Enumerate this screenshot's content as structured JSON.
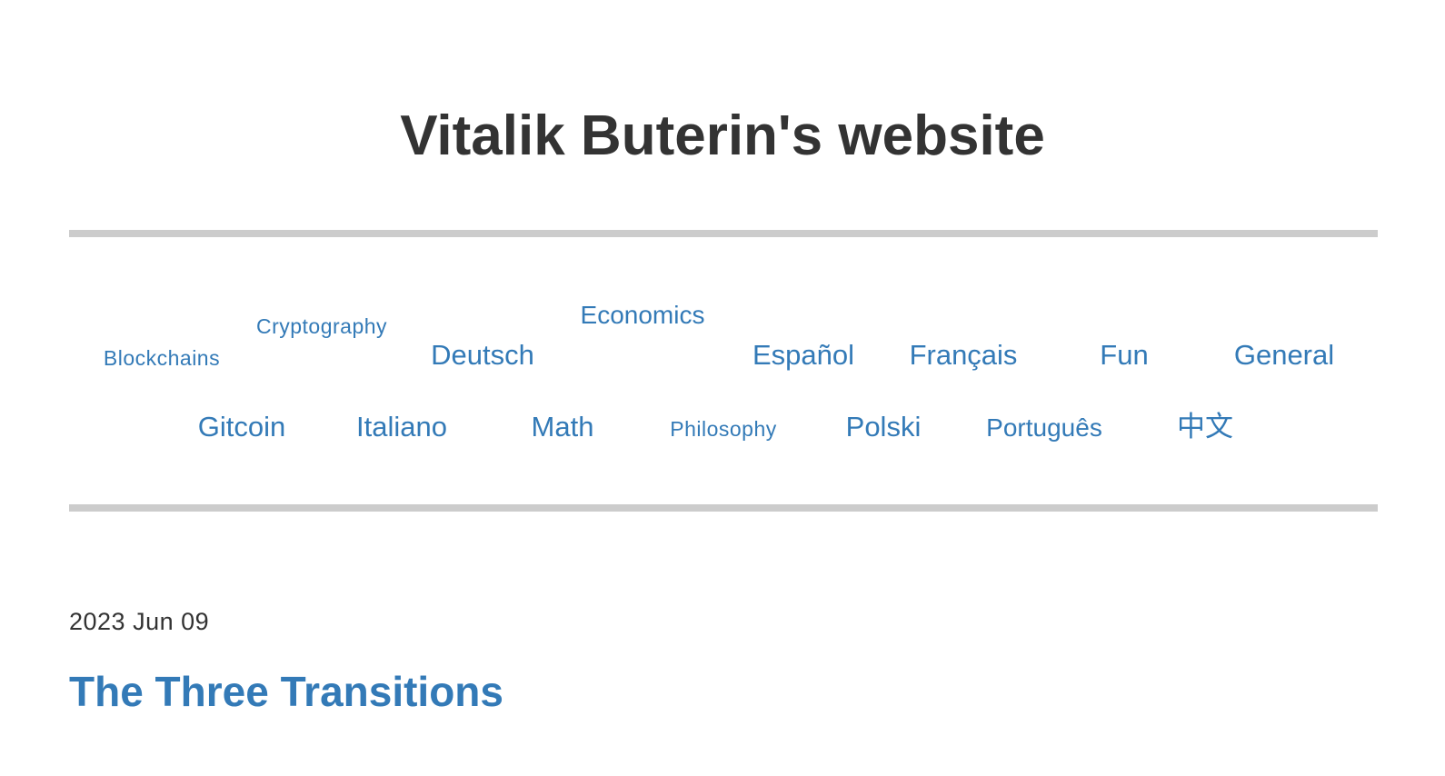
{
  "site": {
    "title": "Vitalik Buterin's website",
    "link_color": "#337ab7",
    "text_color": "#333333",
    "rule_color": "#cccccc"
  },
  "categories": [
    "Blockchains",
    "Cryptography",
    "Deutsch",
    "Economics",
    "Español",
    "Français",
    "Fun",
    "General",
    "Gitcoin",
    "Italiano",
    "Math",
    "Philosophy",
    "Polski",
    "Português",
    "中文"
  ],
  "post": {
    "date": "2023 Jun 09",
    "title": "The Three Transitions"
  }
}
